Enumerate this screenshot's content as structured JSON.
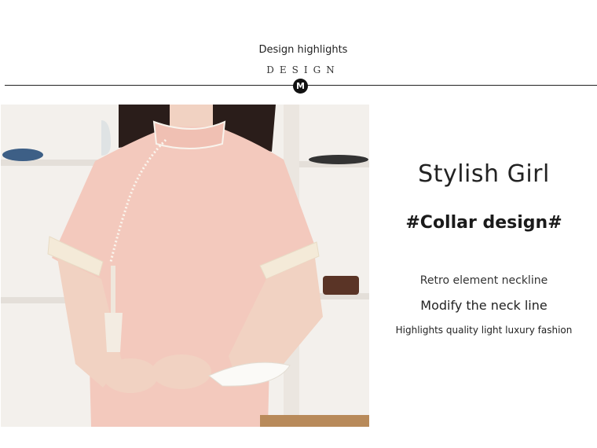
{
  "header": {
    "title": "Design highlights",
    "subtitle": "DESIGN",
    "badge": "M"
  },
  "product": {
    "headline": "Stylish Girl",
    "feature_tag": "#Collar design#",
    "lines": [
      "Retro element neckline",
      "Modify the neck line",
      "Highlights quality light luxury fashion"
    ]
  },
  "colors": {
    "dress": "#f3c9bd",
    "background": "#ffffff",
    "text": "#1a1a1a"
  }
}
